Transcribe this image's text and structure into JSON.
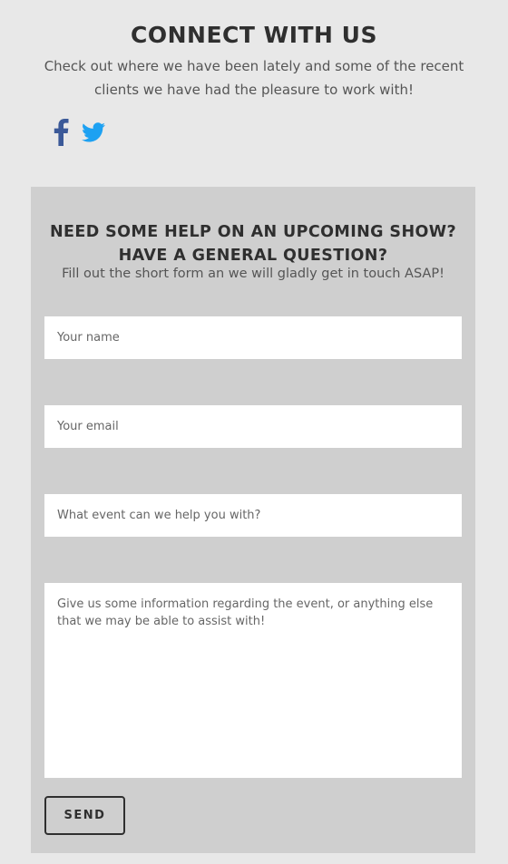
{
  "connect": {
    "title": "CONNECT WITH US",
    "text": "Check out where we have been lately and some of the recent clients we have had the pleasure to work with!",
    "social": [
      {
        "name": "facebook-icon",
        "color": "#3b5998"
      },
      {
        "name": "twitter-icon",
        "color": "#1da1f2"
      }
    ]
  },
  "form": {
    "title_line1": "NEED SOME HELP ON AN UPCOMING SHOW?",
    "title_line2": "HAVE A GENERAL QUESTION?",
    "subtitle": "Fill out the short form an we will gladly get in touch ASAP!",
    "name_placeholder": "Your name",
    "email_placeholder": "Your email",
    "event_placeholder": "What event can we help you with?",
    "message_placeholder": "Give us some information regarding the event, or anything else that we may be able to assist with!",
    "send_label": "SEND"
  },
  "colors": {
    "page_background": "#e8e8e8",
    "panel_background": "#cfcfcf",
    "heading": "#2f2f2f",
    "body_text": "#555555"
  }
}
